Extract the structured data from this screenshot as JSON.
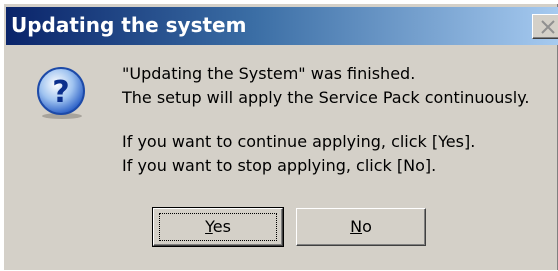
{
  "window": {
    "title": "Updating the system"
  },
  "icons": {
    "dialog": "question-icon",
    "close": "close-icon"
  },
  "message": {
    "line1": "\"Updating the System\" was finished.",
    "line2": "The setup will apply the Service Pack continuously.",
    "line3": "If you want to continue applying, click [Yes].",
    "line4": "If you want to stop applying, click [No]."
  },
  "buttons": {
    "yes": {
      "mnemonic": "Y",
      "rest": "es"
    },
    "no": {
      "mnemonic": "N",
      "rest": "o"
    }
  },
  "colors": {
    "titlebar_start": "#0a246a",
    "titlebar_end": "#a6caf0",
    "dialog_background": "#d4d0c8"
  }
}
